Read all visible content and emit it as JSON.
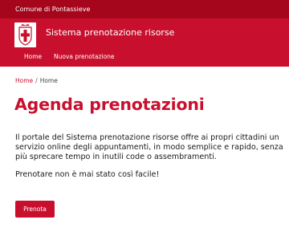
{
  "topbar": {
    "municipality": "Comune di Pontassieve"
  },
  "header": {
    "site_title": "Sistema prenotazione risorse"
  },
  "nav": {
    "items": [
      {
        "label": "Home"
      },
      {
        "label": "Nuova prenotazione"
      }
    ]
  },
  "breadcrumb": {
    "link": "Home",
    "separator": "/",
    "current": "Home"
  },
  "main": {
    "title": "Agenda prenotazioni",
    "intro": "Il portale del Sistema prenotazione risorse offre ai propri cittadini un servizio online degli appuntamenti, in modo semplice e rapido, senza più sprecare tempo in inutili code o assembramenti.",
    "tagline": "Prenotare non è mai stato così facile!",
    "button_label": "Prenota"
  },
  "colors": {
    "brand_red": "#c8102e",
    "topbar_red": "#a5061b",
    "text": "#1a1a1a"
  },
  "icons": {
    "crest": "municipal-crest-icon"
  }
}
